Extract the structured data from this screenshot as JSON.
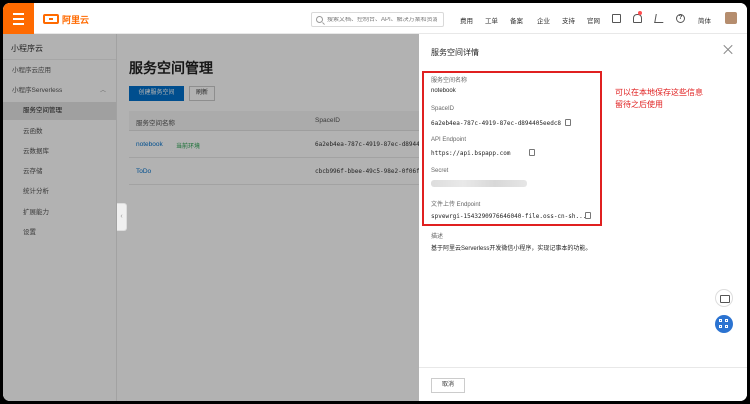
{
  "header": {
    "logo_text": "阿里云",
    "search_placeholder": "搜索文档、控制台、API、解决方案和资源",
    "nav": [
      "费用",
      "工单",
      "备案",
      "企业",
      "支持",
      "官网"
    ],
    "lang": "简体"
  },
  "sidebar": {
    "title": "小程序云",
    "items": [
      {
        "label": "小程序云应用"
      },
      {
        "label": "小程序Serverless"
      },
      {
        "label": "服务空间管理"
      },
      {
        "label": "云函数"
      },
      {
        "label": "云数据库"
      },
      {
        "label": "云存储"
      },
      {
        "label": "统计分析"
      },
      {
        "label": "扩展能力"
      },
      {
        "label": "设置"
      }
    ]
  },
  "main": {
    "title": "服务空间管理",
    "create_button": "创建服务空间",
    "refresh_button": "刷新",
    "columns": [
      "服务空间名称",
      "SpaceID"
    ],
    "rows": [
      {
        "name": "notebook",
        "tag": "当前环境",
        "space_id": "6a2eb4ea-787c-4919-87ec-d894405"
      },
      {
        "name": "ToDo",
        "tag": "",
        "space_id": "cbcb996f-bbee-49c5-98e2-0f06f71"
      }
    ]
  },
  "drawer": {
    "title": "服务空间详情",
    "fields": [
      {
        "label": "服务空间名称",
        "value": "notebook"
      },
      {
        "label": "SpaceID",
        "value": "6a2eb4ea-787c-4919-87ec-d894405eedc8"
      },
      {
        "label": "API Endpoint",
        "value": "https://api.bspapp.com"
      },
      {
        "label": "Secret",
        "value": ""
      },
      {
        "label": "文件上传 Endpoint",
        "value": "spvewrgi-1543290976646040-file.oss-cn-sh..."
      },
      {
        "label": "描述",
        "value": "基于阿里云Serverless开发微信小程序，实现记事本的功能。"
      }
    ],
    "cancel_button": "取消"
  },
  "annotation": {
    "line1": "可以在本地保存这些信息",
    "line2": "留待之后使用"
  },
  "colors": {
    "brand": "#ff6a00",
    "primary": "#0070cc",
    "annotation_red": "#e02020",
    "tag_green": "#1e9e48"
  }
}
